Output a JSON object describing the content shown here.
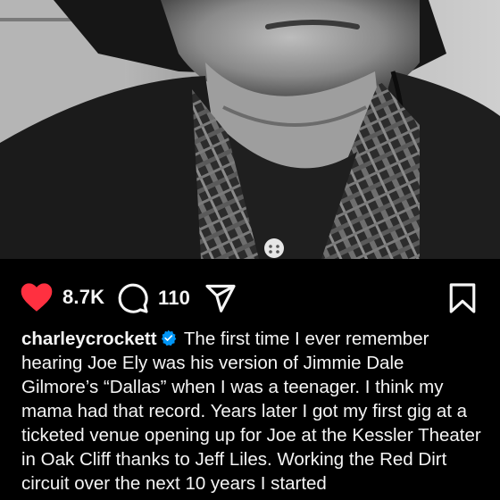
{
  "post": {
    "likes": "8.7K",
    "comments": "110",
    "username": "charleycrockett",
    "caption": "The first time I ever remember hearing Joe Ely was his version of Jimmie Dale Gilmore’s “Dallas” when I was a teenager. I think my mama had that record. Years later I got my first gig at a ticketed venue opening up for Joe at the Kessler Theater in Oak Cliff thanks to Jeff Liles. Working the Red Dirt circuit over the next 10 years I started"
  },
  "icons": {
    "like": "heart-icon",
    "comment": "comment-icon",
    "share": "share-icon",
    "save": "bookmark-icon",
    "verified": "verified-badge-icon"
  },
  "colors": {
    "background": "#000000",
    "text": "#f5f5f5",
    "heart": "#ff3040",
    "verified": "#0095f6"
  }
}
